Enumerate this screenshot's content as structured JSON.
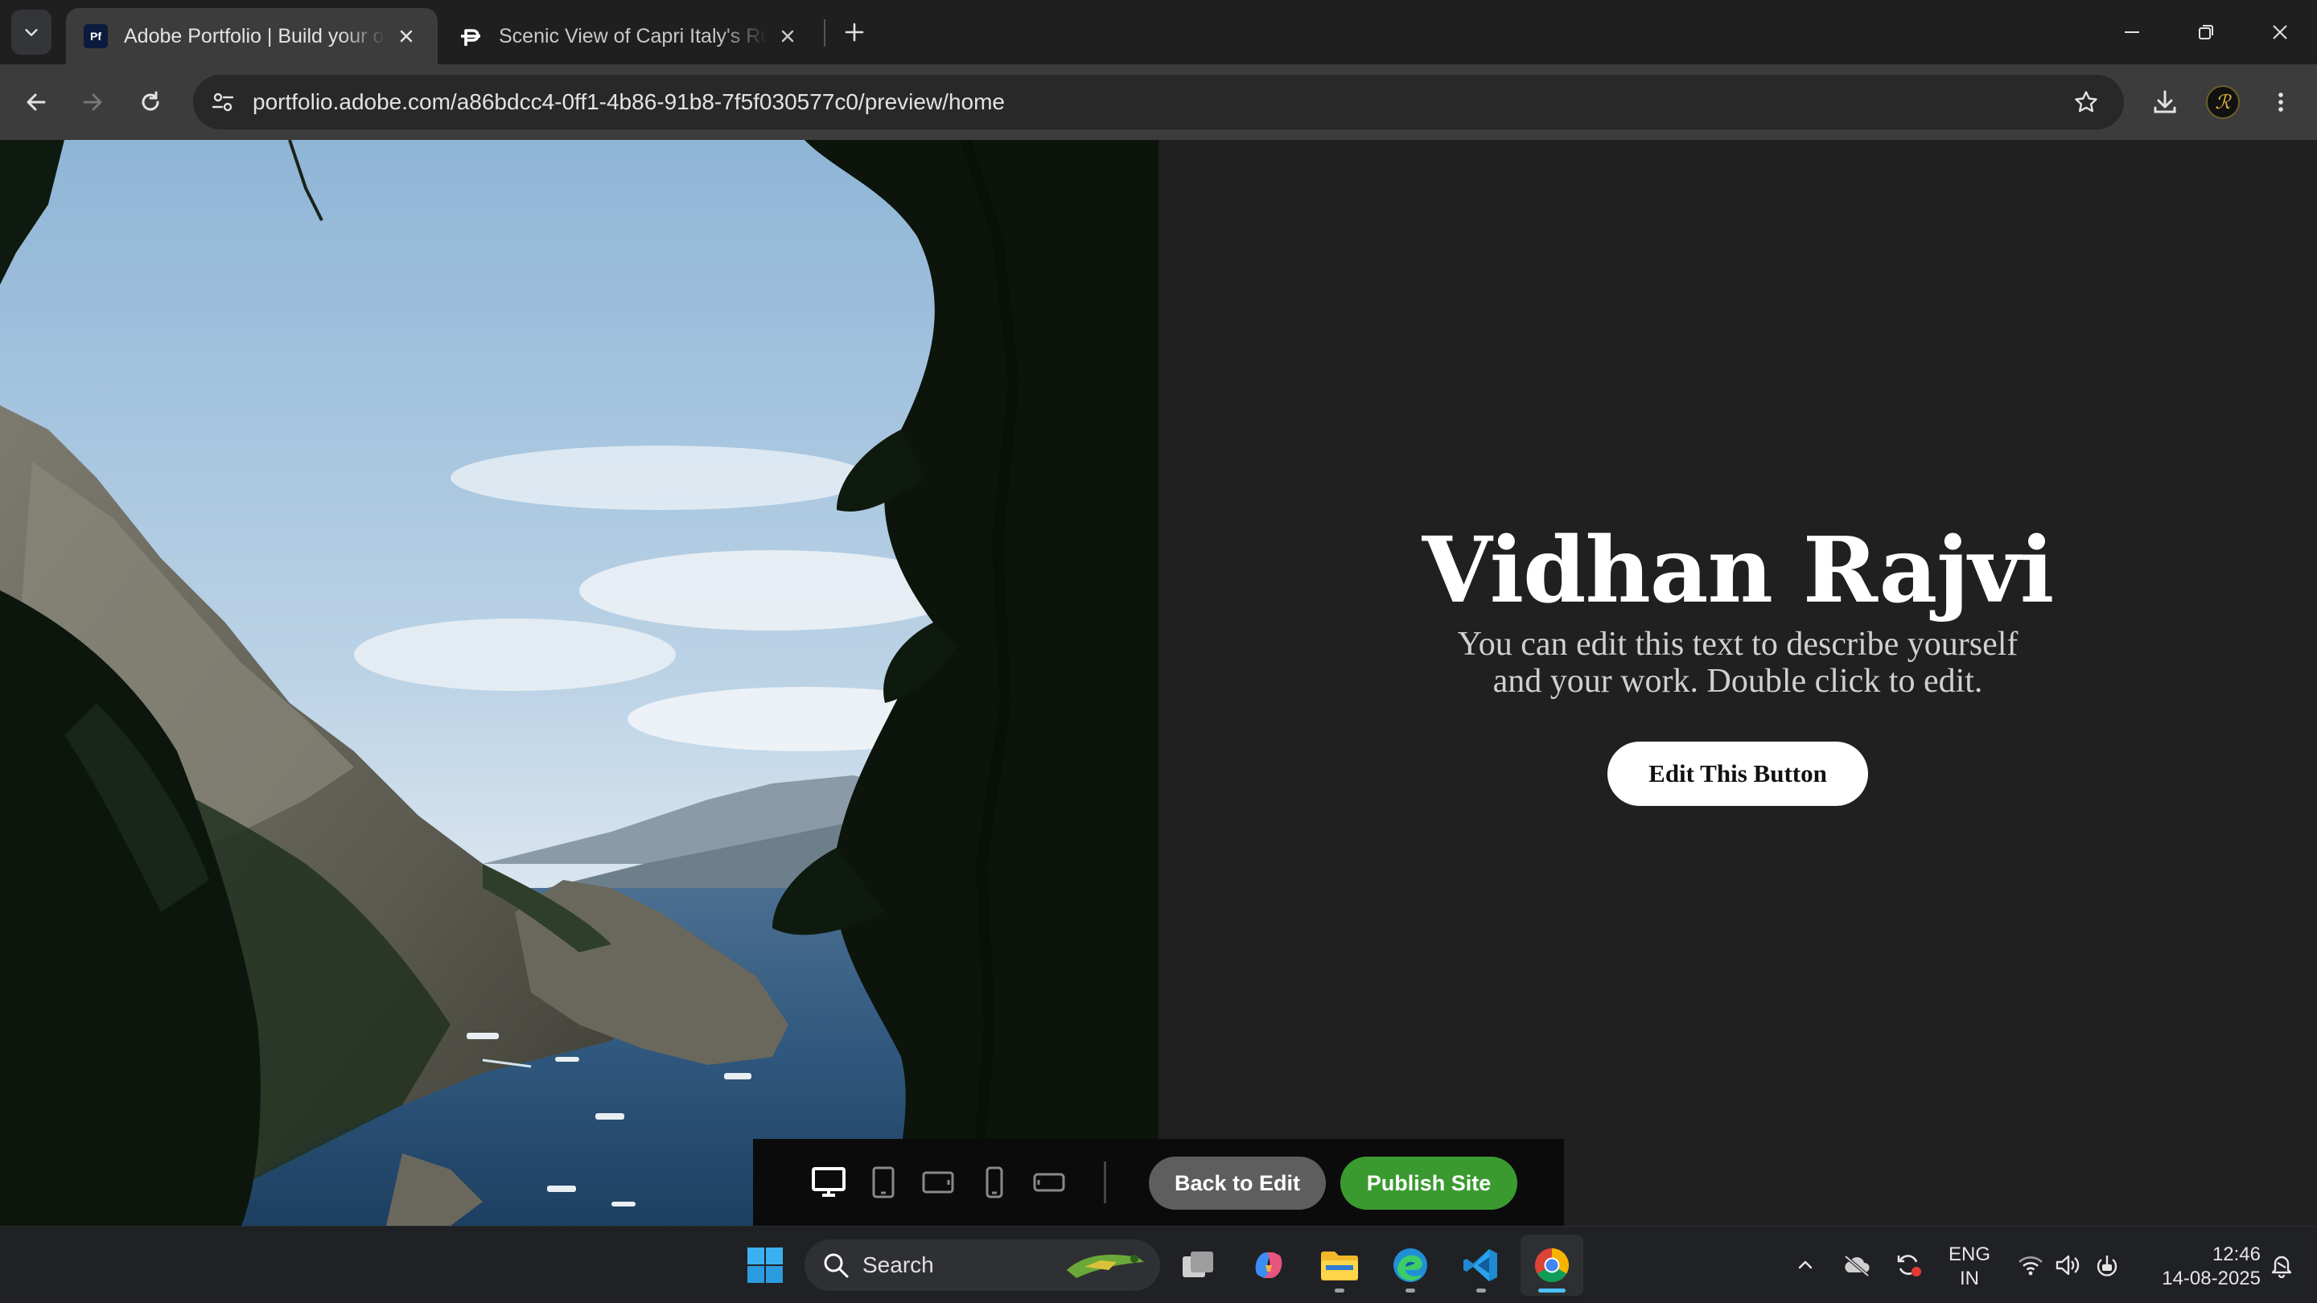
{
  "browser": {
    "tabs": [
      {
        "title": "Adobe Portfolio | Build your own personalized website",
        "favicon": "Pf",
        "active": true
      },
      {
        "title": "Scenic View of Capri Italy's Rugged Coastline",
        "active": false
      }
    ],
    "url": "portfolio.adobe.com/a86bdcc4-0ff1-4b86-91b8-7f5f030577c0/preview/home"
  },
  "hero": {
    "name": "Vidhan Rajvi",
    "description": "You can edit this text to describe yourself and your work. Double click to edit.",
    "button_label": "Edit This Button"
  },
  "preview_bar": {
    "devices": [
      "desktop-icon",
      "tablet-portrait-icon",
      "tablet-landscape-icon",
      "phone-portrait-icon",
      "phone-landscape-icon"
    ],
    "back_label": "Back to Edit",
    "publish_label": "Publish Site",
    "colors": {
      "publish": "#3a9a30",
      "back": "#5e5e5e"
    }
  },
  "taskbar": {
    "search_placeholder": "Search",
    "language": "ENG",
    "region": "IN",
    "time": "12:46",
    "date": "14-08-2025"
  }
}
